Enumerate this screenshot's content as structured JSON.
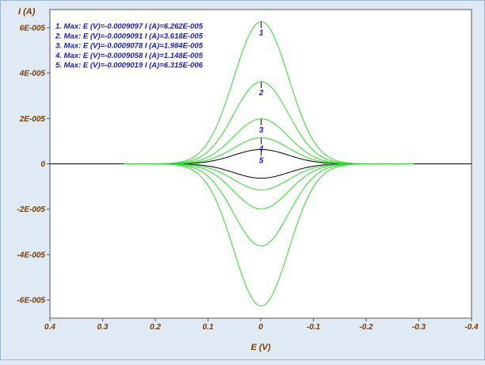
{
  "chart_data": {
    "type": "line",
    "xlabel": "E (V)",
    "ylabel": "I (A)",
    "xlim": [
      0.4,
      -0.4
    ],
    "ylim": [
      -6.8e-05,
      6.8e-05
    ],
    "x_ticks": [
      0.4,
      0.3,
      0.2,
      0.1,
      0,
      -0.1,
      -0.2,
      -0.3,
      -0.4
    ],
    "x_tick_labels": [
      "0.4",
      "0.3",
      "0.2",
      "0.1",
      "0",
      "-0.1",
      "-0.2",
      "-0.3",
      "-0.4"
    ],
    "y_ticks": [
      6e-05,
      4e-05,
      2e-05,
      0,
      -2e-05,
      -4e-05,
      -6e-05
    ],
    "y_tick_labels": [
      "6E-005",
      "4E-005",
      "2E-005",
      "0",
      "-2E-005",
      "-4E-005",
      "-6E-005"
    ],
    "grid": false,
    "colors": {
      "axis_text": "#7a3c00",
      "legend_text": "#1a1acc",
      "green_series": "#2ddc2d",
      "black_series": "#000000",
      "background": "#ffffff"
    },
    "peak_width_sigma_v": 0.052,
    "series": [
      {
        "label": "1",
        "color": "#2ddc2d",
        "peak_x": -0.0009097,
        "peak_y": 6.262e-05,
        "x_range": [
          0.26,
          -0.29
        ]
      },
      {
        "label": "2",
        "color": "#2ddc2d",
        "peak_x": -0.0009091,
        "peak_y": 3.618e-05,
        "x_range": [
          0.26,
          -0.29
        ]
      },
      {
        "label": "3",
        "color": "#2ddc2d",
        "peak_x": -0.0009078,
        "peak_y": 1.984e-05,
        "x_range": [
          0.26,
          -0.29
        ]
      },
      {
        "label": "4",
        "color": "#2ddc2d",
        "peak_x": -0.0009058,
        "peak_y": 1.148e-05,
        "x_range": [
          0.26,
          -0.29
        ]
      },
      {
        "label": "5",
        "color": "#000000",
        "peak_x": -0.0009019,
        "peak_y": 6.315e-06,
        "x_range": [
          0.4,
          -0.4
        ]
      }
    ],
    "annotations": [
      "1. Max: E (V)=-0.0009097  I (A)=6.262E-005",
      "2. Max: E (V)=-0.0009091  I (A)=3.618E-005",
      "3. Max: E (V)=-0.0009078  I (A)=1.984E-005",
      "4. Max: E (V)=-0.0009058  I (A)=1.148E-005",
      "5. Max: E (V)=-0.0009019  I (A)=6.315E-006"
    ]
  }
}
